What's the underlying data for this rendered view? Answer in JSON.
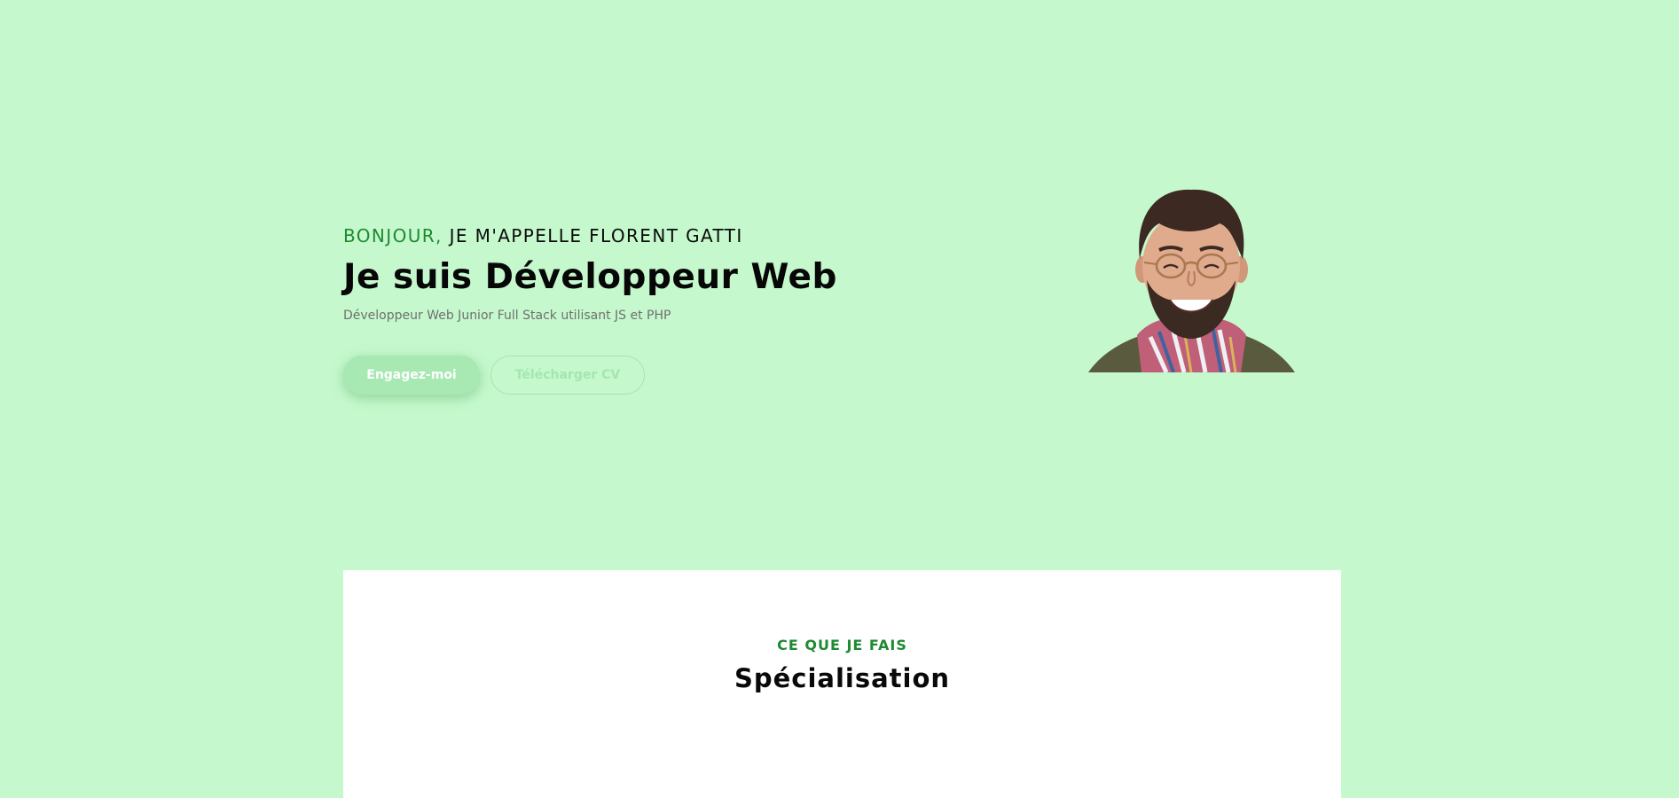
{
  "hero": {
    "greeting_accent": "BONJOUR,",
    "greeting_rest": " JE M'APPELLE FLORENT GATTI",
    "headline": "Je suis Développeur Web",
    "subline": "Développeur Web Junior Full Stack utilisant JS et PHP",
    "primary_button": "Engagez-moi",
    "secondary_button": "Télécharger CV",
    "portrait_icon": "profile-photo"
  },
  "section": {
    "kicker": "CE QUE JE FAIS",
    "title": "Spécialisation"
  },
  "colors": {
    "background": "#c5f9cd",
    "accent": "#1f8a32",
    "primary_button": "#a8e8b3",
    "card": "#ffffff"
  }
}
